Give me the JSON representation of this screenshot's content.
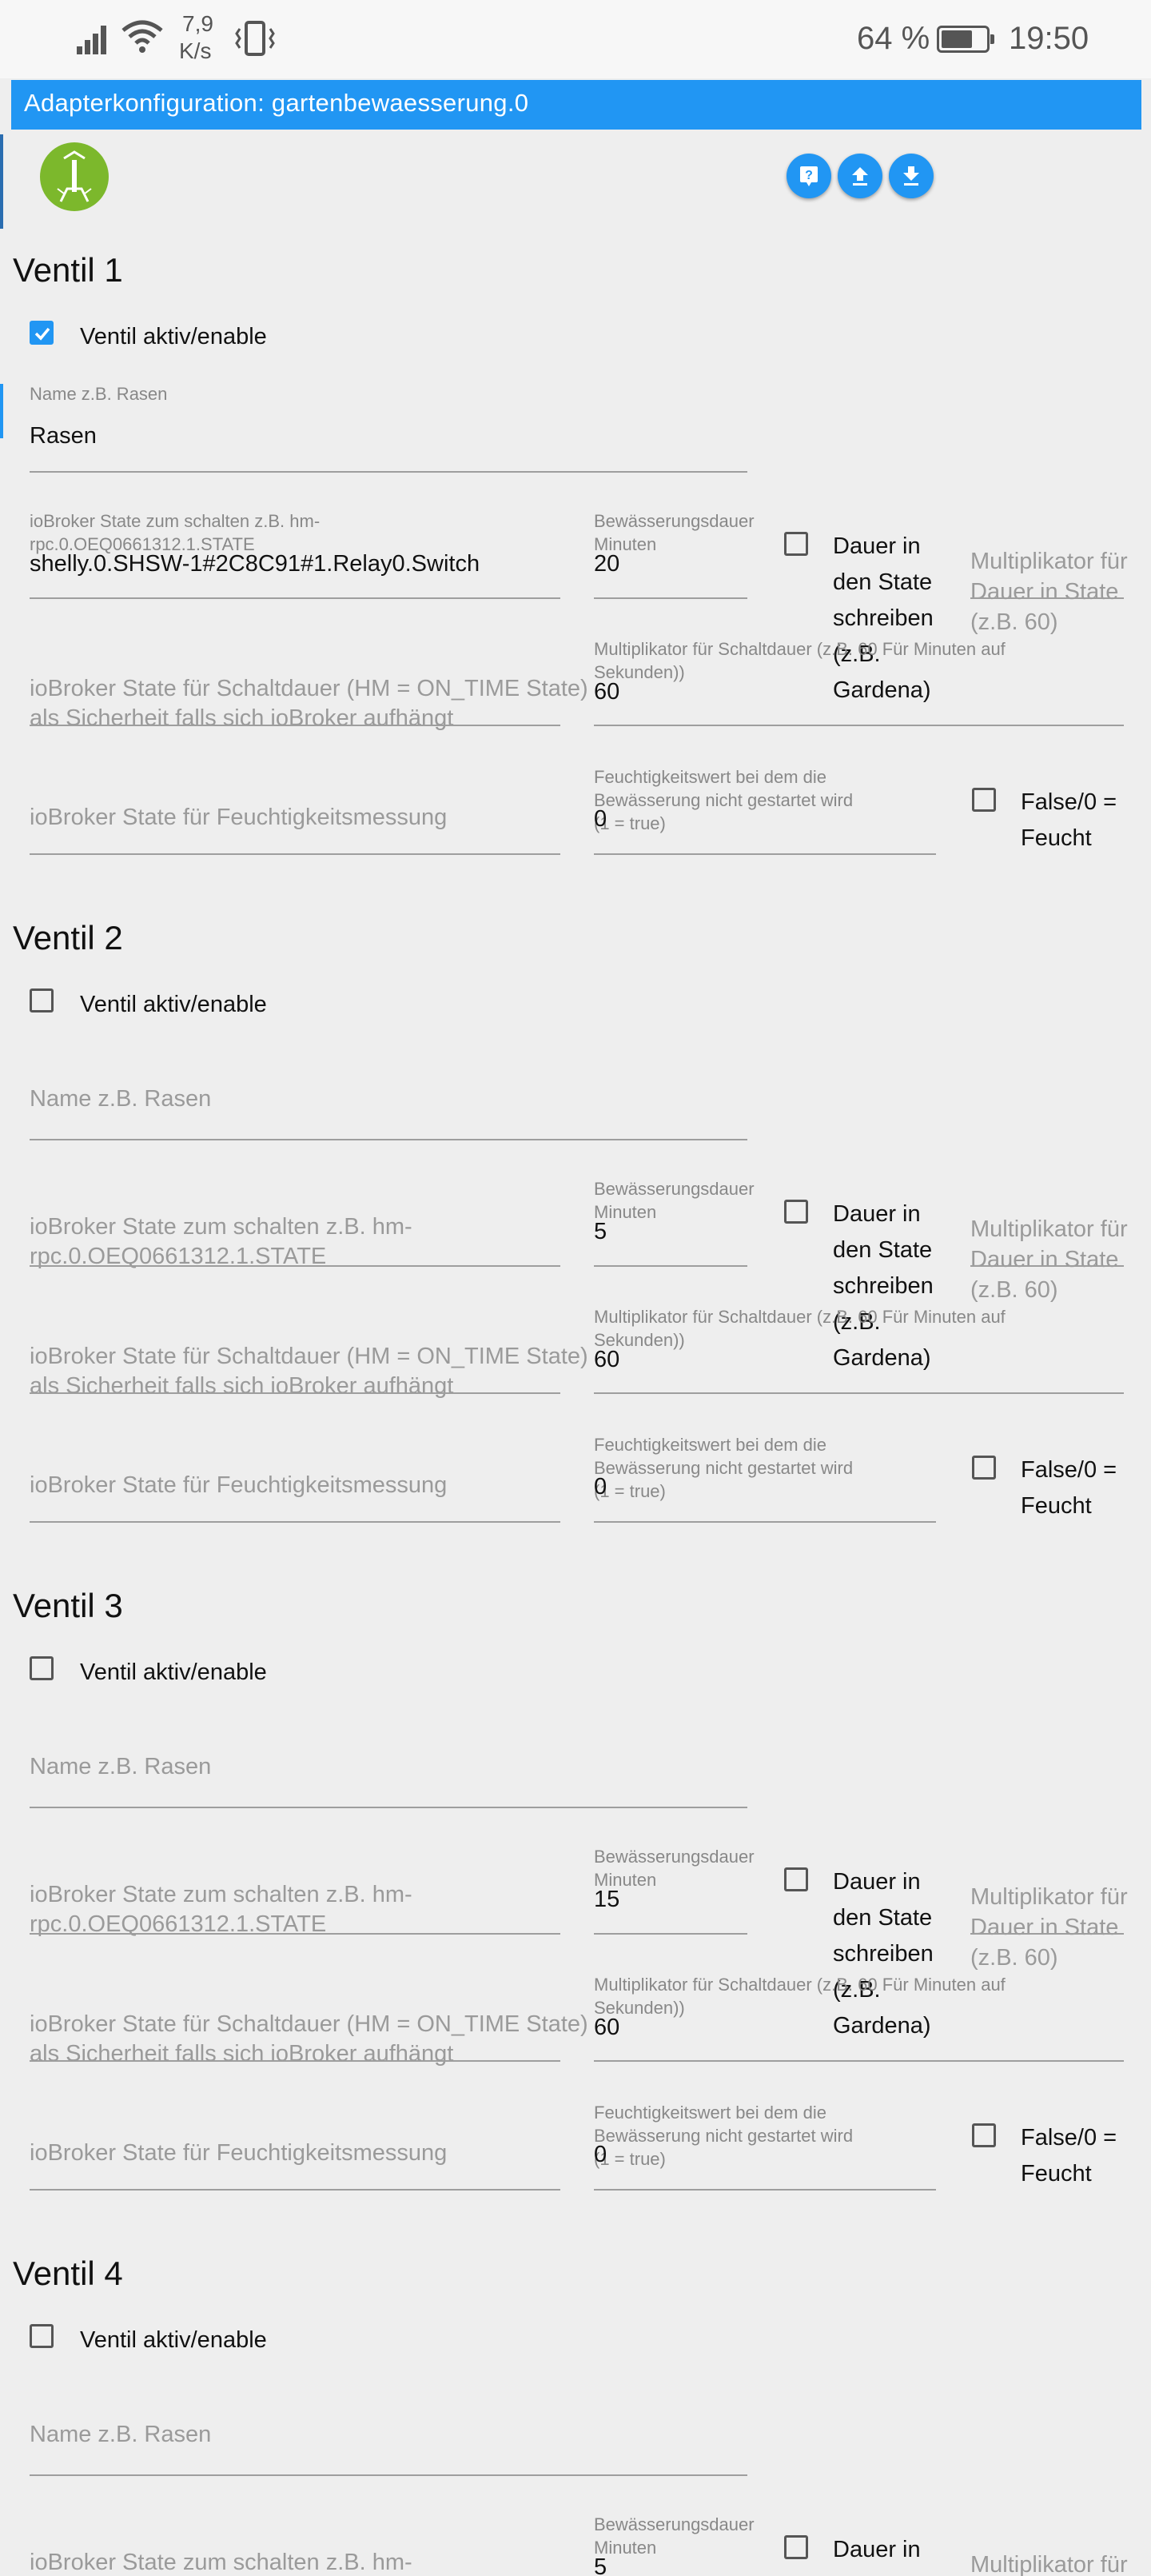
{
  "status": {
    "speed_value": "7,9",
    "speed_unit": "K/s",
    "battery_percent": "64 %",
    "time": "19:50"
  },
  "header": {
    "title": "Adapterkonfiguration: gartenbewaesserung.0"
  },
  "toolbar": {
    "icons": [
      "help-icon",
      "upload-icon",
      "download-icon"
    ]
  },
  "labels": {
    "enable": "Ventil aktiv/enable",
    "name_placeholder": "Name z.B. Rasen",
    "state_placeholder_line1": "ioBroker State zum schalten z.B. hm-",
    "state_placeholder_line2": "rpc.0.OEQ0661312.1.STATE",
    "duration_label_line1": "Bewässerungsdauer",
    "duration_label_line2": "Minuten",
    "write_duration_line1": "Dauer in",
    "write_duration_line2": "den State",
    "write_duration_line3": "schreiben",
    "write_duration_line4": "(z.B.",
    "write_duration_line5": "Gardena)",
    "multiplier_placeholder_line1": "Multiplikator für",
    "multiplier_placeholder_line2": "Dauer in State",
    "multiplier_placeholder_line3": "(z.B. 60)",
    "ontime_placeholder_line1": "ioBroker State für Schaltdauer (HM = ON_TIME State)",
    "ontime_placeholder_line2": "als Sicherheit falls sich ioBroker aufhängt",
    "multiplier2_label_line1": "Multiplikator für Schaltdauer (z.B. 60 Für Minuten auf",
    "multiplier2_label_line2": "Sekunden))",
    "humidity_placeholder": "ioBroker State für Feuchtigkeitsmessung",
    "humidity_threshold_line1": "Feuchtigkeitswert bei dem die",
    "humidity_threshold_line2": "Bewässerung nicht gestartet wird",
    "humidity_threshold_line3": "(1 = true)",
    "false_wet_line1": "False/0 =",
    "false_wet_line2": "Feucht"
  },
  "valves": [
    {
      "title": "Ventil 1",
      "enabled": true,
      "name": "Rasen",
      "state": "shelly.0.SHSW-1#2C8C91#1.Relay0.Switch",
      "duration": "20",
      "write_duration": false,
      "multiplier_ontime": "60",
      "humidity_threshold": "0",
      "false_wet": false
    },
    {
      "title": "Ventil 2",
      "enabled": false,
      "name": "",
      "state": "",
      "duration": "5",
      "write_duration": false,
      "multiplier_ontime": "60",
      "humidity_threshold": "0",
      "false_wet": false
    },
    {
      "title": "Ventil 3",
      "enabled": false,
      "name": "",
      "state": "",
      "duration": "15",
      "write_duration": false,
      "multiplier_ontime": "60",
      "humidity_threshold": "0",
      "false_wet": false
    },
    {
      "title": "Ventil 4",
      "enabled": false,
      "name": "",
      "state": "",
      "duration": "5",
      "write_duration": false
    }
  ]
}
